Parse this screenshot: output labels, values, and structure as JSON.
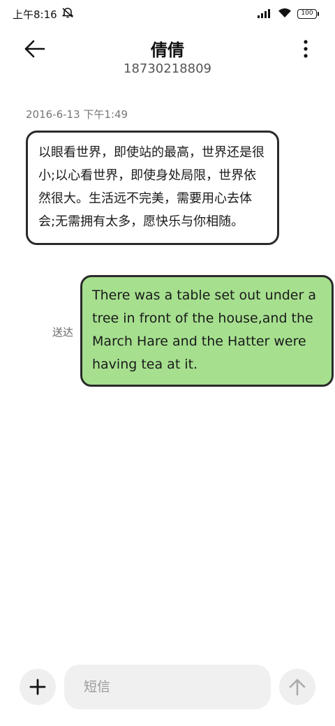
{
  "status_bar": {
    "time": "上午8:16",
    "mute_icon": "bell-off-icon",
    "signal_icon": "signal-icon",
    "wifi_icon": "wifi-icon",
    "battery_level": "100"
  },
  "header": {
    "contact_name": "倩倩",
    "phone_number": "18730218809",
    "back_icon": "arrow-left-icon",
    "menu_icon": "more-vertical-icon"
  },
  "messages": {
    "timestamp": "2016-6-13 下午1:49",
    "incoming": {
      "text": "以眼看世界，即使站的最高，世界还是很小;以心看世界，即使身处局限，世界依然很大。生活远不完美，需要用心去体会;无需拥有太多，愿快乐与你相随。"
    },
    "outgoing": {
      "text": "There was a table set out under a tree in front of the house,and the March Hare and the Hatter were having tea at it.",
      "status": "送达"
    }
  },
  "composer": {
    "placeholder": "短信",
    "value": "",
    "plus_icon": "plus-icon",
    "send_icon": "arrow-up-icon"
  },
  "colors": {
    "outgoing_bubble": "#a6e08f",
    "incoming_bubble": "#ffffff",
    "bubble_border": "#2a2a2a",
    "button_bg": "#efefef"
  }
}
